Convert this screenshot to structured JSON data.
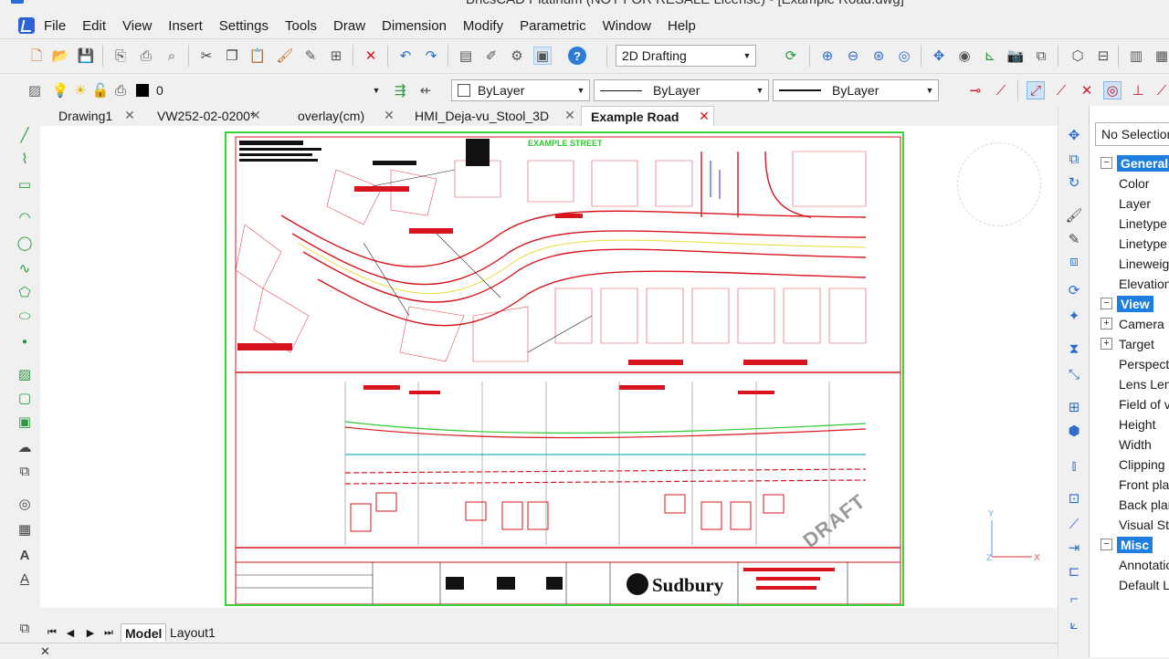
{
  "window": {
    "title": "BricsCAD Platinum (NOT FOR RESALE License) - [Example Road.dwg]"
  },
  "menu": [
    "File",
    "Edit",
    "View",
    "Insert",
    "Settings",
    "Tools",
    "Draw",
    "Dimension",
    "Modify",
    "Parametric",
    "Window",
    "Help"
  ],
  "toolbar": {
    "workspace": "2D Drafting"
  },
  "layerbar": {
    "layer_value": "0",
    "color": "ByLayer",
    "linetype": "ByLayer",
    "lineweight": "ByLayer"
  },
  "tabs": [
    {
      "label": "Drawing1"
    },
    {
      "label": "VW252-02-0200*"
    },
    {
      "label": "overlay(cm)"
    },
    {
      "label": "HMI_Deja-vu_Stool_3D"
    },
    {
      "label": "Example Road"
    }
  ],
  "drawing": {
    "watermark": "DRAFT",
    "logo_text": "Sudbury",
    "street_label": "EXAMPLE STREET"
  },
  "properties": {
    "selection": "No Selection",
    "rows": [
      {
        "label": "General",
        "category": true,
        "toggle": "−"
      },
      {
        "label": "Color"
      },
      {
        "label": "Layer"
      },
      {
        "label": "Linetype"
      },
      {
        "label": "Linetype s"
      },
      {
        "label": "Lineweigh"
      },
      {
        "label": "Elevation"
      },
      {
        "label": "View",
        "category": true,
        "toggle": "−"
      },
      {
        "label": "Camera",
        "toggle": "+"
      },
      {
        "label": "Target",
        "toggle": "+"
      },
      {
        "label": "Perspectiv"
      },
      {
        "label": "Lens Leng"
      },
      {
        "label": "Field of vi"
      },
      {
        "label": "Height"
      },
      {
        "label": "Width"
      },
      {
        "label": "Clipping"
      },
      {
        "label": "Front plan"
      },
      {
        "label": "Back plan"
      },
      {
        "label": "Visual Sty"
      },
      {
        "label": "Misc",
        "category": true,
        "toggle": "−"
      },
      {
        "label": "Annotatio"
      },
      {
        "label": "Default Li"
      }
    ]
  },
  "layout_tabs": [
    "Model",
    "Layout1"
  ],
  "colors": {
    "accent": "#1e7fe0",
    "sheet_border": "#39d239",
    "drawing_red": "#d8141e"
  }
}
